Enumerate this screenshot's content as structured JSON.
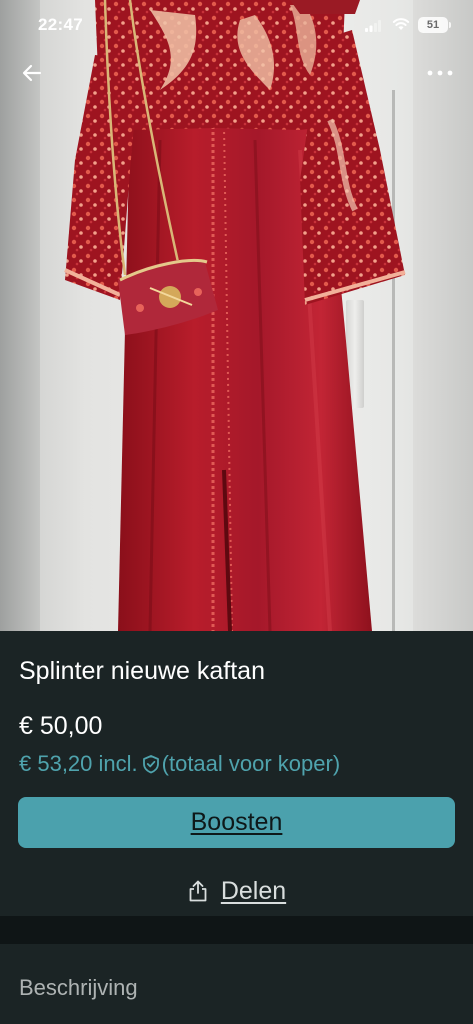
{
  "status_bar": {
    "time": "22:47",
    "battery_level": "51"
  },
  "nav": {
    "back_icon": "arrow-left-icon",
    "more_icon": "more-horizontal-icon"
  },
  "product": {
    "title": "Splinter nieuwe kaftan",
    "price": "€ 50,00",
    "price_incl": "€ 53,20 incl.",
    "price_incl_note": "(totaal voor koper)",
    "shield_icon": "shield-check-icon"
  },
  "actions": {
    "boost_label": "Boosten",
    "share_label": "Delen",
    "share_icon": "share-icon"
  },
  "description": {
    "heading": "Beschrijving"
  },
  "colors": {
    "background": "#1b2425",
    "accent": "#4ba1ad",
    "accent_text": "#4fa3ad",
    "divider": "#0f1516"
  }
}
